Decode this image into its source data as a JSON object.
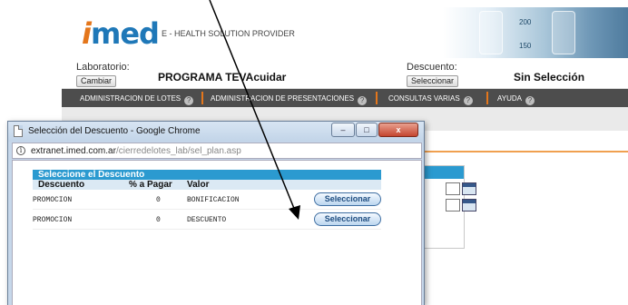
{
  "banner": {
    "logo": "imed",
    "tagline": "E - HEALTH SOLUTION PROVIDER",
    "photo_marks": [
      "200",
      "150"
    ]
  },
  "info": {
    "lab_label": "Laboratorio:",
    "lab_button": "Cambiar",
    "lab_value": "PROGRAMA TEVAcuidar",
    "discount_label": "Descuento:",
    "discount_button": "Seleccionar",
    "discount_value": "Sin Selección"
  },
  "menu": {
    "items": [
      "ADMINISTRACION DE LOTES",
      "ADMINISTRACION DE PRESENTACIONES",
      "CONSULTAS VARIAS",
      "AYUDA"
    ],
    "help_glyph": "?"
  },
  "popup": {
    "title": "Selección del Descuento - Google Chrome",
    "url_host": "extranet.imed.com.ar",
    "url_path": "/cierredelotes_lab/sel_plan.asp",
    "table_title": "Seleccione el Descuento",
    "columns": [
      "Descuento",
      "% a Pagar",
      "Valor"
    ],
    "rows": [
      {
        "descuento": "PROMOCION",
        "pagar": "0",
        "valor": "BONIFICACION",
        "button": "Seleccionar"
      },
      {
        "descuento": "PROMOCION",
        "pagar": "0",
        "valor": "DESCUENTO",
        "button": "Seleccionar"
      }
    ],
    "window_buttons": {
      "minimize": "–",
      "maximize": "□",
      "close": "x"
    }
  },
  "colors": {
    "brand_blue": "#1f78b8",
    "brand_orange": "#e4761b",
    "table_header": "#2b9ad0",
    "menu_bg": "#4d4d4d"
  }
}
